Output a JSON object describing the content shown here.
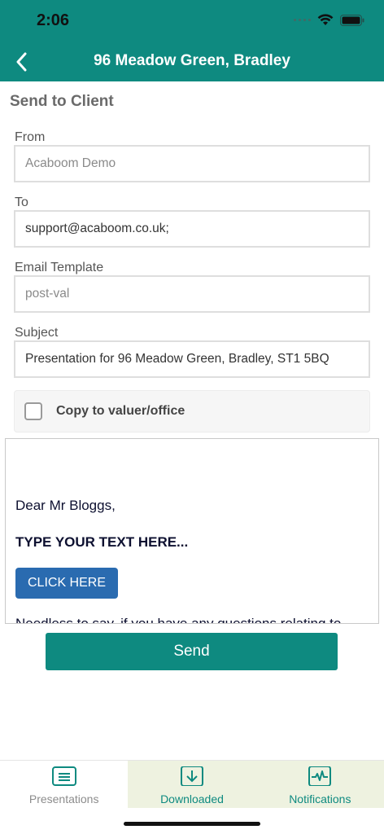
{
  "status_bar": {
    "time": "2:06"
  },
  "nav": {
    "title": "96 Meadow Green, Bradley"
  },
  "page": {
    "section_title": "Send to Client"
  },
  "form": {
    "from_label": "From",
    "from_value": "Acaboom Demo",
    "to_label": "To",
    "to_value": "support@acaboom.co.uk;",
    "template_label": "Email Template",
    "template_value": "post-val",
    "subject_label": "Subject",
    "subject_value": "Presentation for 96 Meadow Green, Bradley, ST1 5BQ",
    "copy_label": "Copy to valuer/office",
    "copy_checked": false
  },
  "email_body": {
    "greeting": "Dear Mr Bloggs,",
    "placeholder_heading": "TYPE YOUR TEXT HERE...",
    "button_label": "CLICK HERE",
    "cut_paragraph": "Needless to say, if you have any questions relating to"
  },
  "actions": {
    "send_label": "Send"
  },
  "tabs": [
    {
      "label": "Presentations",
      "icon": "list-icon",
      "active": false
    },
    {
      "label": "Downloaded",
      "icon": "download-icon",
      "active": true
    },
    {
      "label": "Notifications",
      "icon": "activity-icon",
      "active": true
    }
  ],
  "colors": {
    "brand": "#0e8a80",
    "email_button": "#2a6bb0",
    "tab_active_bg": "#eef2e0"
  }
}
